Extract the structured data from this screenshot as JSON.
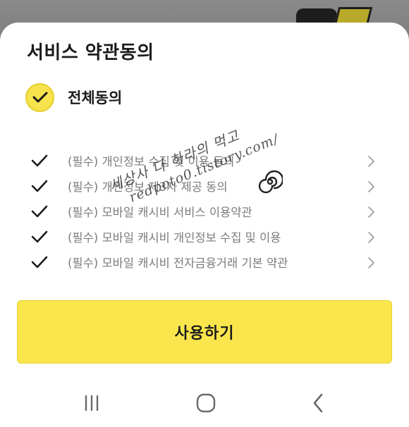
{
  "dialog": {
    "title": "서비스 약관동의",
    "agree_all_label": "전체동의",
    "terms": [
      {
        "label": "(필수) 개인정보 수집 및 이용 동의"
      },
      {
        "label": "(필수) 개인정보 제3자 제공 동의"
      },
      {
        "label": "(필수) 모바일 캐시비 서비스 이용약관"
      },
      {
        "label": "(필수) 모바일 캐시비 개인정보 수집 및 이용"
      },
      {
        "label": "(필수) 모바일 캐시비 전자금융거래 기본 약관"
      }
    ],
    "submit_label": "사용하기"
  },
  "watermark": {
    "line1": "세상사 다 하라의 먹고",
    "line2": "redpoto0.tistory.com/"
  },
  "colors": {
    "accent_yellow": "#fae64c",
    "check_circle": "#f7e34b",
    "term_text": "#7b7b7b"
  },
  "icons": {
    "agree_all": "check-circle-icon",
    "term_check": "check-icon",
    "term_arrow": "chevron-right-icon",
    "nav_recents": "recent-apps-icon",
    "nav_home": "home-icon",
    "nav_back": "back-icon"
  }
}
